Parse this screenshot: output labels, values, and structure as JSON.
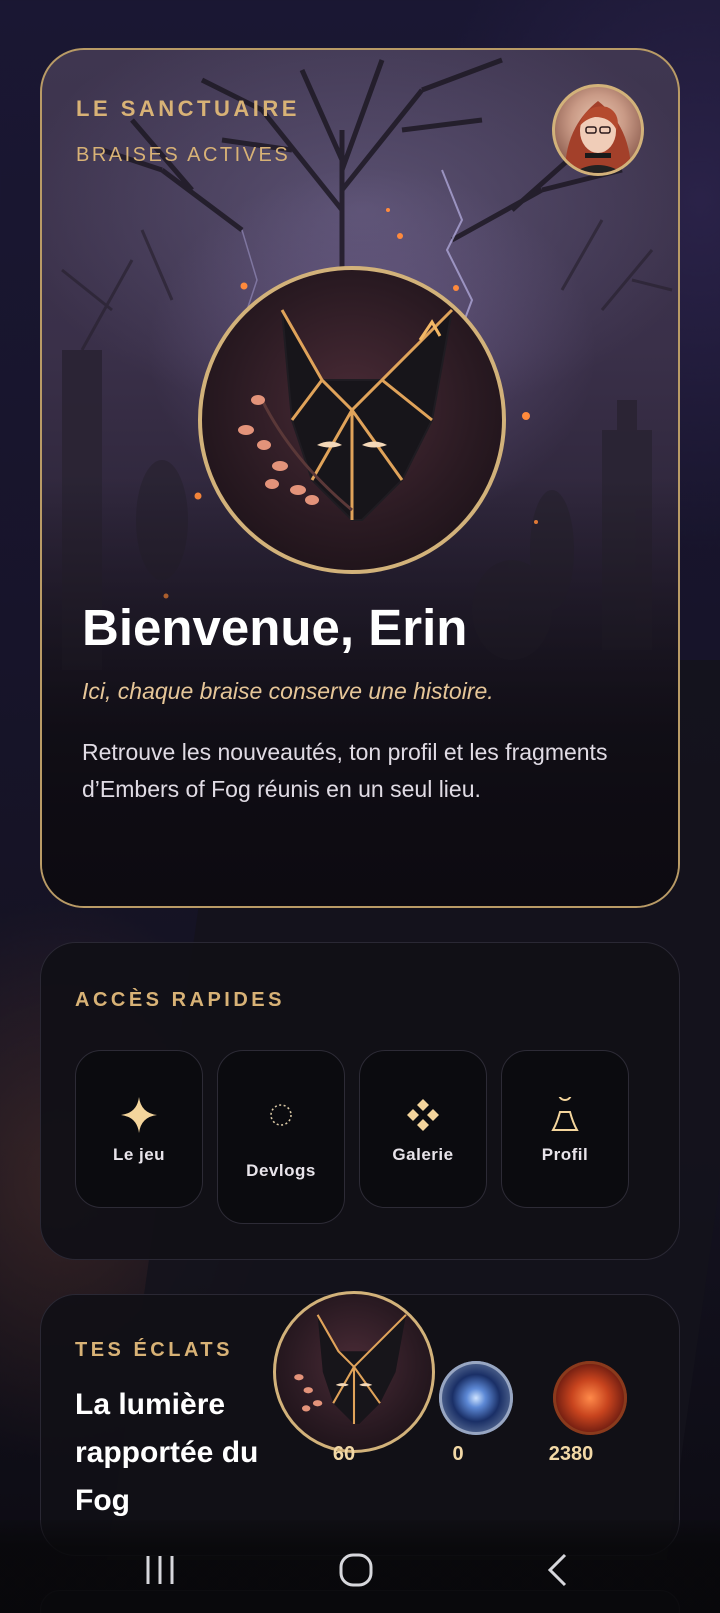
{
  "hero": {
    "eyebrow": "LE SANCTUAIRE",
    "sub_eyebrow": "BRAISES ACTIVES",
    "welcome": "Bienvenue, Erin",
    "tagline": "Ici, chaque braise conserve une histoire.",
    "description": "Retrouve les nouveautés, ton profil et les fragments d’Embers of Fog réunis en un seul lieu."
  },
  "quick_access": {
    "title": "ACCÈS RAPIDES",
    "tiles": [
      {
        "label": "Le jeu",
        "icon": "sparkle-star-icon"
      },
      {
        "label": "Devlogs",
        "icon": "dotted-circle-icon"
      },
      {
        "label": "Galerie",
        "icon": "diamond-cluster-icon"
      },
      {
        "label": "Profil",
        "icon": "pawn-icon"
      }
    ]
  },
  "shards": {
    "title": "TES ÉCLATS",
    "headline": "La lumière rapportée du Fog",
    "counters": [
      {
        "value": "60",
        "icon": "fox-emblem"
      },
      {
        "value": "0",
        "icon": "moon-coin"
      },
      {
        "value": "2380",
        "icon": "heart-coin"
      }
    ]
  },
  "colors": {
    "accent_gold": "#d8b276",
    "border_gold": "#d2b27a",
    "card_dark": "#111016"
  }
}
